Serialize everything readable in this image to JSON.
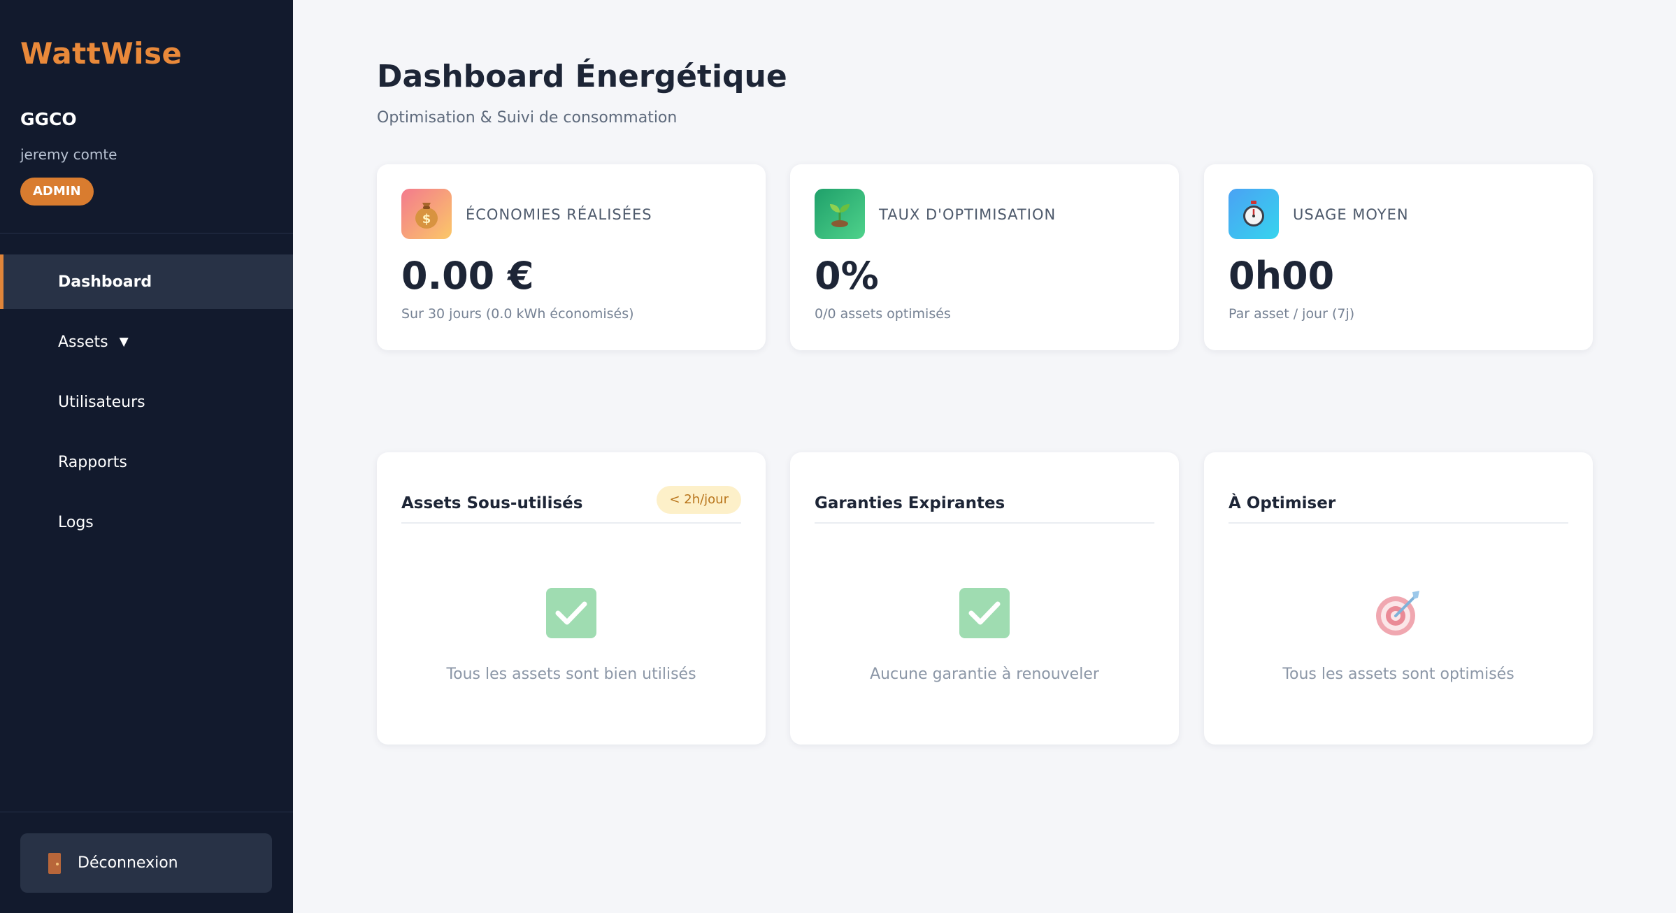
{
  "sidebar": {
    "brand": "WattWise",
    "org": "GGCO",
    "user": "jeremy comte",
    "role": "ADMIN",
    "nav": [
      {
        "label": "Dashboard",
        "active": true
      },
      {
        "label": "Assets",
        "caret": "▼"
      },
      {
        "label": "Utilisateurs"
      },
      {
        "label": "Rapports"
      },
      {
        "label": "Logs"
      }
    ],
    "logout": "Déconnexion"
  },
  "header": {
    "title": "Dashboard Énergétique",
    "subtitle": "Optimisation & Suivi de consommation"
  },
  "stats": [
    {
      "icon": "money-bag-icon",
      "label": "ÉCONOMIES RÉALISÉES",
      "value": "0.00 €",
      "sub": "Sur 30 jours (0.0 kWh économisés)"
    },
    {
      "icon": "seedling-icon",
      "label": "TAUX D'OPTIMISATION",
      "value": "0%",
      "sub": "0/0 assets optimisés"
    },
    {
      "icon": "stopwatch-icon",
      "label": "USAGE MOYEN",
      "value": "0h00",
      "sub": "Par asset / jour (7j)"
    }
  ],
  "lists": [
    {
      "title": "Assets Sous-utilisés",
      "badge": "< 2h/jour",
      "icon": "check-icon",
      "empty": "Tous les assets sont bien utilisés"
    },
    {
      "title": "Garanties Expirantes",
      "icon": "check-icon",
      "empty": "Aucune garantie à renouveler"
    },
    {
      "title": "À Optimiser",
      "icon": "target-icon",
      "empty": "Tous les assets sont optimisés"
    }
  ],
  "colors": {
    "sidebar_bg": "#121a2d",
    "accent": "#e9893a",
    "page_bg": "#f5f6f9",
    "text_dark": "#1d2536"
  }
}
